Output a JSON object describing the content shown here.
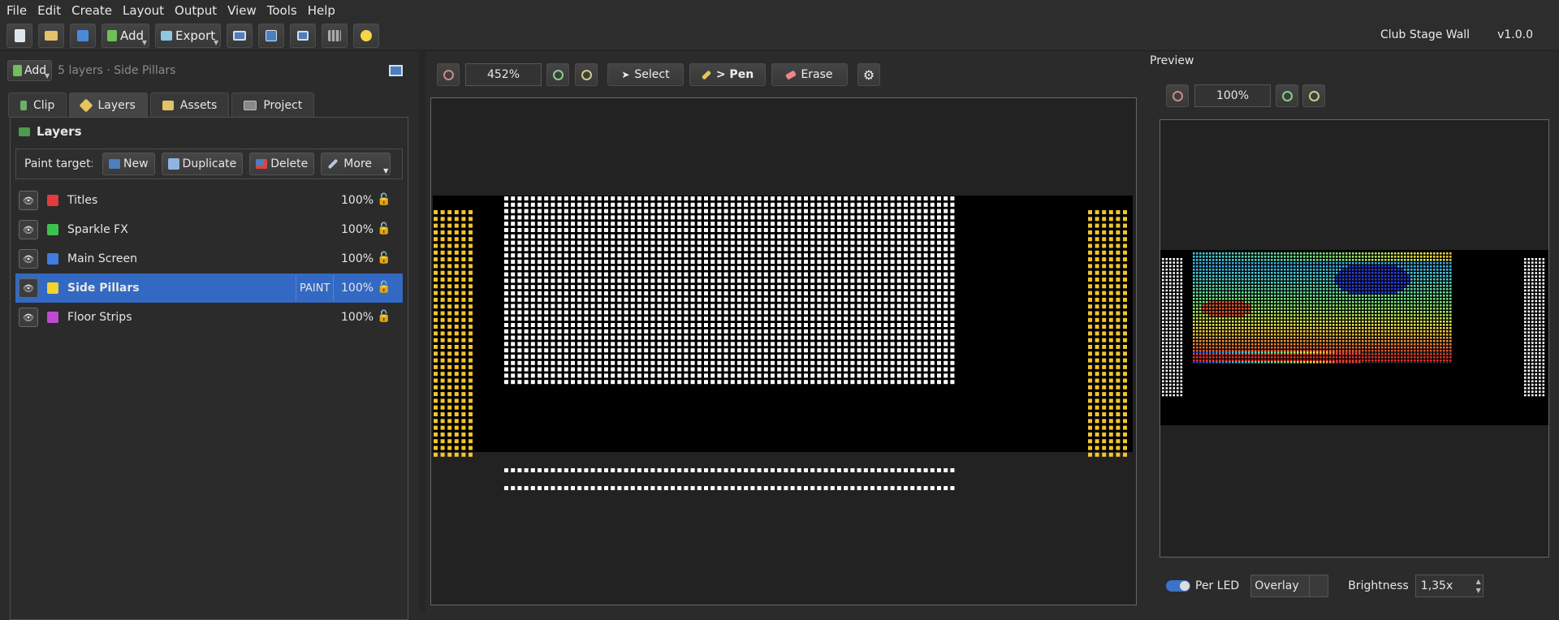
{
  "menu": [
    "File",
    "Edit",
    "Create",
    "Layout",
    "Output",
    "View",
    "Tools",
    "Help"
  ],
  "toolbar": {
    "add_label": "Add",
    "export_label": "Export"
  },
  "header": {
    "project_name": "Club Stage Wall",
    "version": "v1.0.0"
  },
  "left": {
    "add_label": "Add",
    "subtitle": "5 layers · Side Pillars",
    "tabs": [
      {
        "label": "Clip"
      },
      {
        "label": "Layers"
      },
      {
        "label": "Assets"
      },
      {
        "label": "Project"
      }
    ],
    "layers_title": "Layers",
    "paint_target_label": "Paint target: Side Pillars",
    "actions": {
      "new": "New",
      "duplicate": "Duplicate",
      "delete": "Delete",
      "more": "More"
    },
    "paint_tag": "PAINT",
    "layers": [
      {
        "name": "Titles",
        "color": "#e03c3c",
        "opacity": "100%"
      },
      {
        "name": "Sparkle FX",
        "color": "#3cc34c",
        "opacity": "100%"
      },
      {
        "name": "Main Screen",
        "color": "#3f7de0",
        "opacity": "100%"
      },
      {
        "name": "Side Pillars",
        "color": "#f2d22e",
        "opacity": "100%"
      },
      {
        "name": "Floor Strips",
        "color": "#c04ad0",
        "opacity": "100%"
      }
    ]
  },
  "editor": {
    "zoom": "452%",
    "select": "Select",
    "pen": "> Pen",
    "erase": "Erase"
  },
  "preview": {
    "title": "Preview",
    "zoom": "100%",
    "per_led": "Per LED",
    "mode": "Overlay",
    "brightness_label": "Brightness",
    "brightness": "1,35x"
  }
}
